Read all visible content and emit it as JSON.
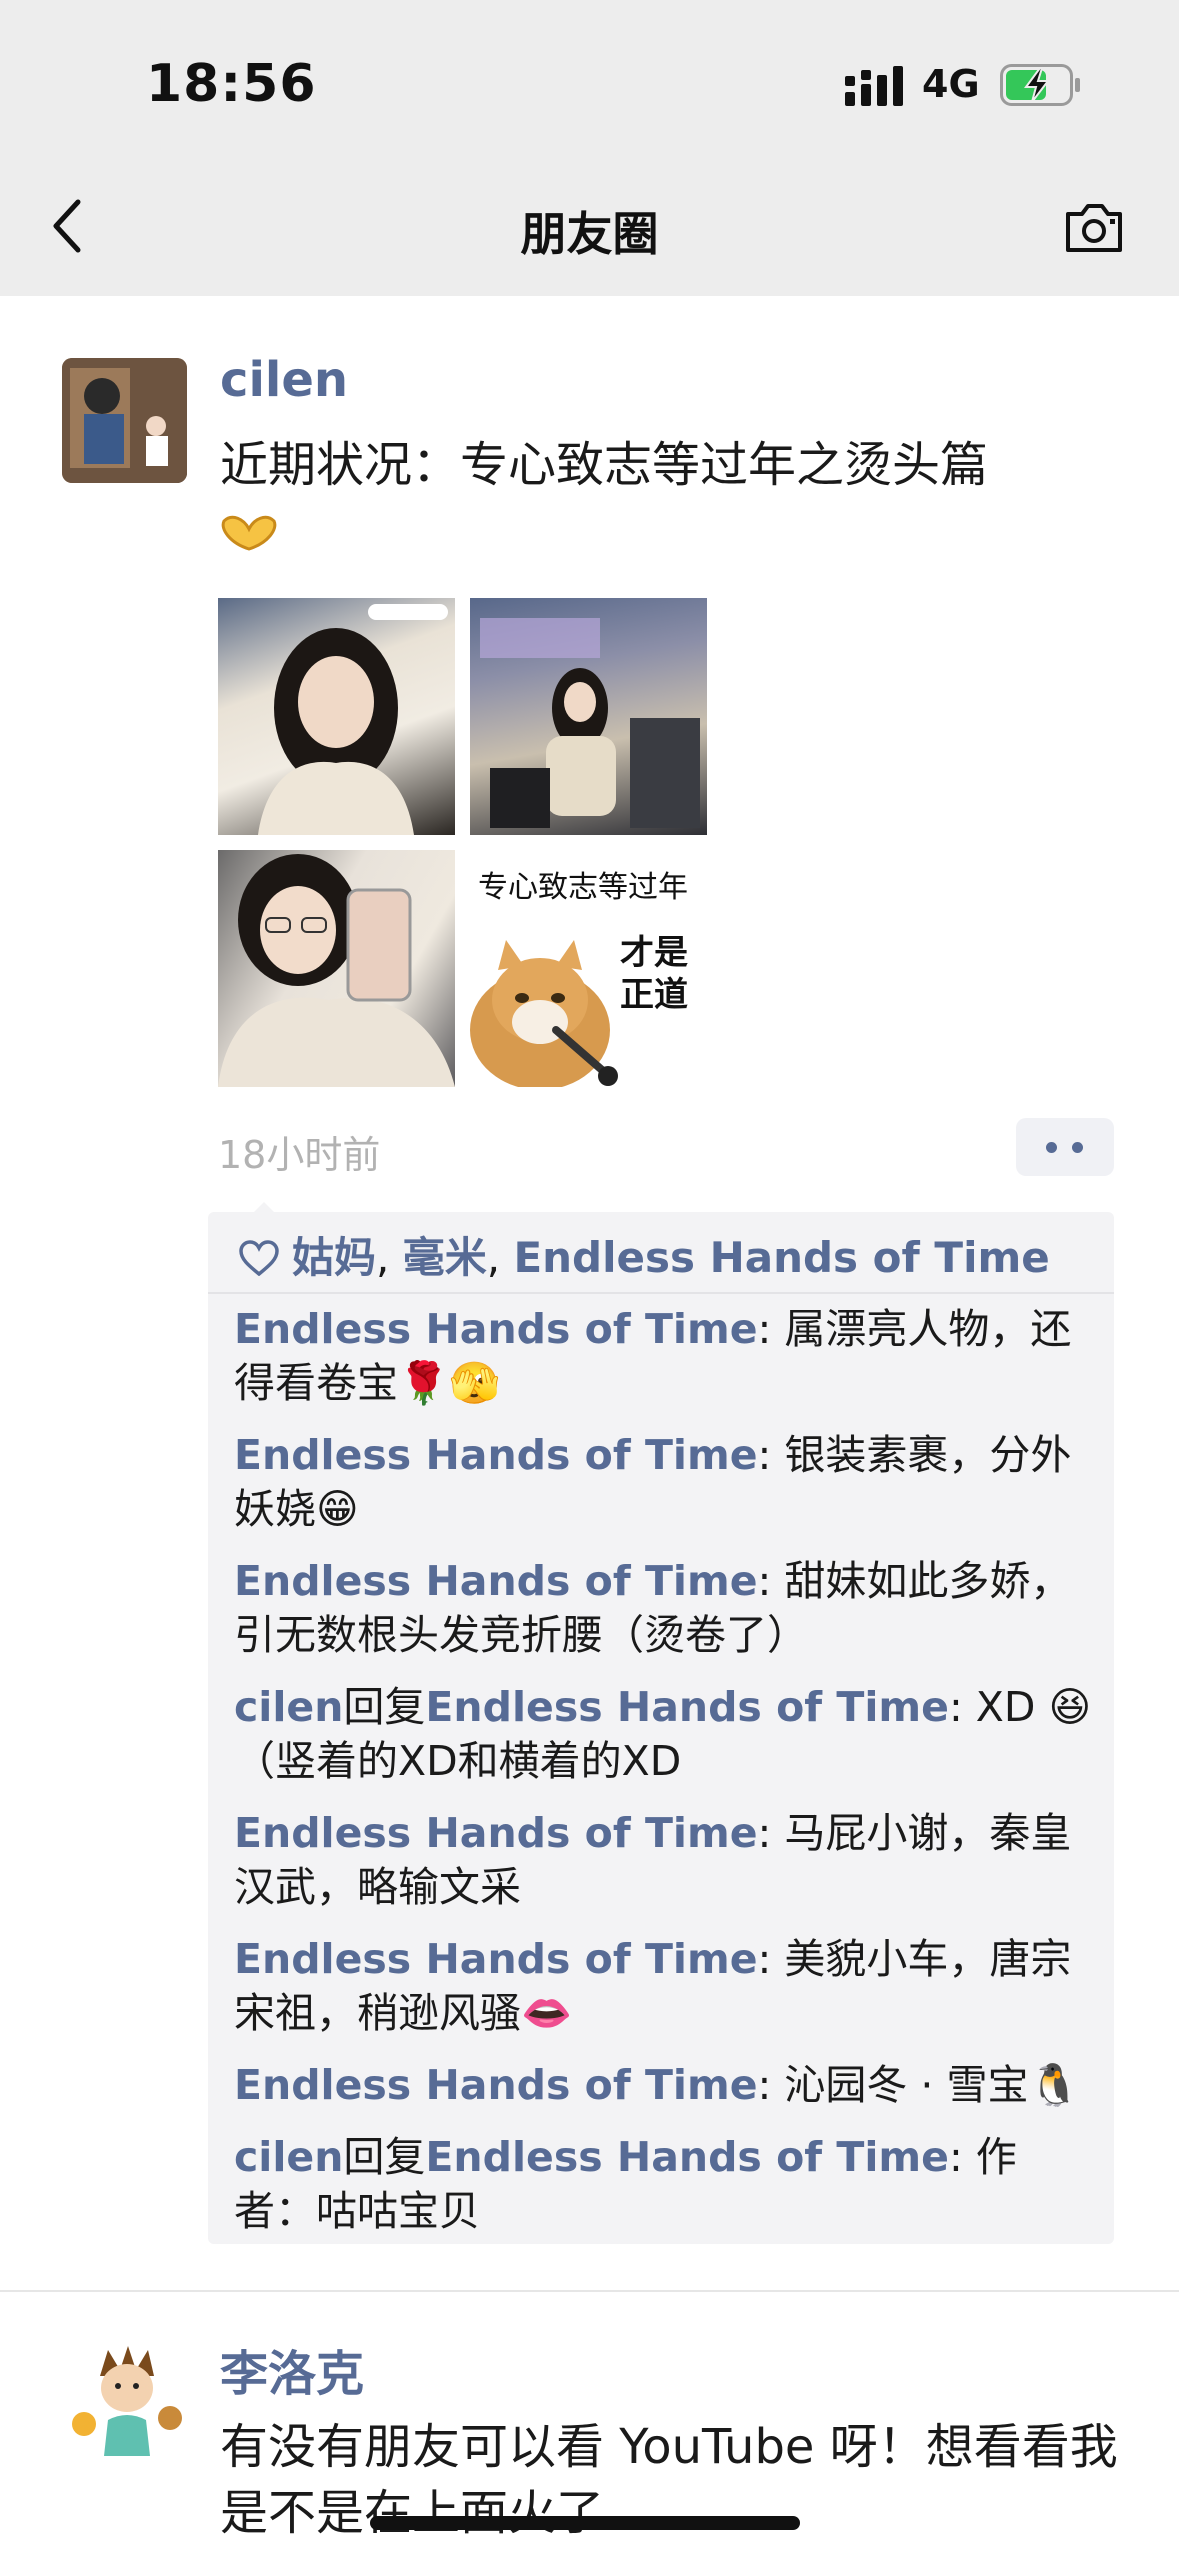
{
  "status_bar": {
    "time": "18:56",
    "network": "4G",
    "icons": [
      "signal-icon",
      "battery-charging-icon"
    ]
  },
  "nav": {
    "title": "朋友圈",
    "icons": [
      "back-icon",
      "camera-icon"
    ]
  },
  "post": {
    "author": "cilen",
    "text": "近期状况：专心致志等过年之烫头篇",
    "photos": {
      "meme_top_text": "专心致志等过年",
      "meme_side_line1": "才是",
      "meme_side_line2": "正道"
    },
    "time": "18小时前",
    "likes": {
      "names": [
        "姑妈",
        "毫米",
        "Endless Hands of Time"
      ],
      "separator": ", "
    },
    "comments": [
      {
        "user": "Endless Hands of Time",
        "sep": ": ",
        "text": "属漂亮人物，还得看卷宝🌹🫣"
      },
      {
        "user": "Endless Hands of Time",
        "sep": ": ",
        "text": "银装素裹，分外妖娆😁"
      },
      {
        "user": "Endless Hands of Time",
        "sep": ": ",
        "text": "甜妹如此多娇，引无数根头发竞折腰（烫卷了）"
      },
      {
        "user": "cilen",
        "reply_word": "回复",
        "reply_to": "Endless Hands of Time",
        "sep": ": ",
        "text": "XD 😆（竖着的XD和横着的XD"
      },
      {
        "user": "Endless Hands of Time",
        "sep": ": ",
        "text": "马屁小谢，秦皇汉武，略输文采"
      },
      {
        "user": "Endless Hands of Time",
        "sep": ": ",
        "text": "美貌小车，唐宗宋祖，稍逊风骚👄"
      },
      {
        "user": "Endless Hands of Time",
        "sep": ": ",
        "text": "沁园冬 · 雪宝🐧"
      },
      {
        "user": "cilen",
        "reply_word": "回复",
        "reply_to": "Endless Hands of Time",
        "sep": ": ",
        "text": "作者：咕咕宝贝"
      }
    ]
  },
  "post2": {
    "author": "李洛克",
    "text": "有没有朋友可以看 YouTube 呀！想看看我是不是在上面火了"
  },
  "colors": {
    "link": "#576b95",
    "nav_bg": "#ededed",
    "comment_bg": "#f3f3f5"
  }
}
